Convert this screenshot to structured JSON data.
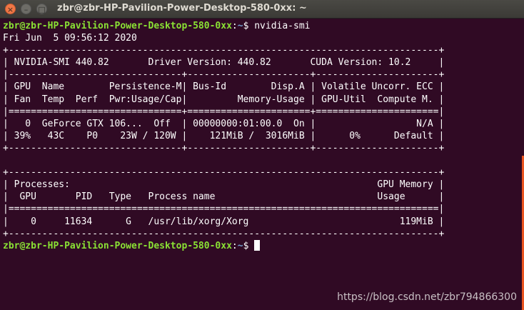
{
  "window": {
    "title": "zbr@zbr-HP-Pavilion-Power-Desktop-580-0xx: ~",
    "close_glyph": "×",
    "minimize_glyph": "–",
    "maximize_glyph": "□"
  },
  "prompt": {
    "user_host": "zbr@zbr-HP-Pavilion-Power-Desktop-580-0xx",
    "sep": ":",
    "path": "~",
    "symbol": "$ "
  },
  "command": "nvidia-smi",
  "output_lines": [
    "Fri Jun  5 09:56:12 2020",
    "+-----------------------------------------------------------------------------+",
    "| NVIDIA-SMI 440.82       Driver Version: 440.82       CUDA Version: 10.2     |",
    "|-------------------------------+----------------------+----------------------+",
    "| GPU  Name        Persistence-M| Bus-Id        Disp.A | Volatile Uncorr. ECC |",
    "| Fan  Temp  Perf  Pwr:Usage/Cap|         Memory-Usage | GPU-Util  Compute M. |",
    "|===============================+======================+======================|",
    "|   0  GeForce GTX 106...  Off  | 00000000:01:00.0  On |                  N/A |",
    "| 39%   43C    P0    23W / 120W |    121MiB /  3016MiB |      0%      Default |",
    "+-------------------------------+----------------------+----------------------+",
    "",
    "+-----------------------------------------------------------------------------+",
    "| Processes:                                                       GPU Memory |",
    "|  GPU       PID   Type   Process name                             Usage      |",
    "|=============================================================================|",
    "|    0     11634      G   /usr/lib/xorg/Xorg                           119MiB |",
    "+-----------------------------------------------------------------------------+"
  ],
  "watermark": "https://blog.csdn.net/zbr794866300",
  "colors": {
    "background": "#300a24",
    "prompt_user": "#8ae234",
    "prompt_path": "#729fcf",
    "text": "#ffffff",
    "scrollbar": "#e95420"
  }
}
